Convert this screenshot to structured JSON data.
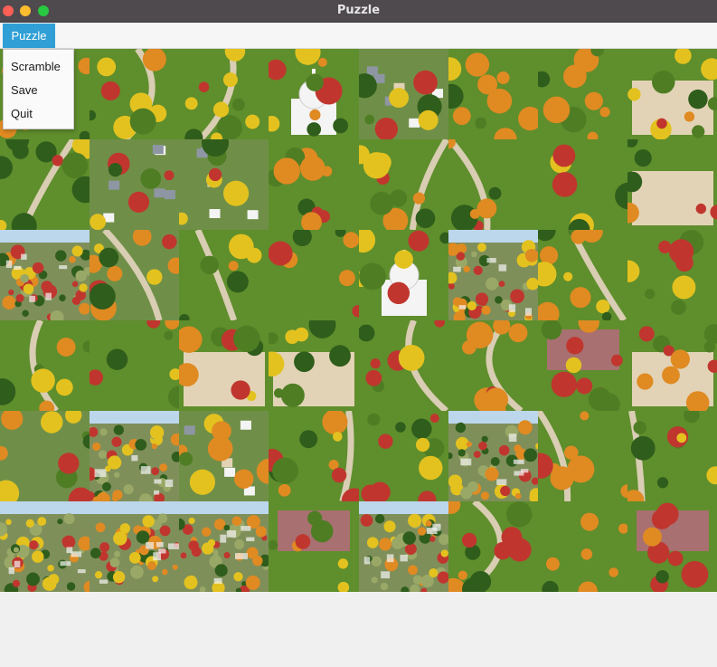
{
  "window": {
    "title": "Puzzle"
  },
  "menubar": {
    "menus": [
      {
        "label": "Puzzle"
      }
    ]
  },
  "dropdown": {
    "items": [
      {
        "label": "Scramble"
      },
      {
        "label": "Save"
      },
      {
        "label": "Quit"
      }
    ]
  },
  "board": {
    "rows": 6,
    "cols": 8,
    "tiles": [
      [
        "trees-grass",
        "trees-path",
        "path-yellow-tree",
        "white-church",
        "campus-houses",
        "orange-trees",
        "orange-tree-grass",
        "building-corner-trees"
      ],
      [
        "trees-path-left",
        "neighborhood-houses",
        "neighborhood-houses",
        "orange-tree-grass",
        "campus-path",
        "trees-path",
        "campus-building",
        "tan-building-facade"
      ],
      [
        "town-skyline",
        "neighborhood-road",
        "yellow-tree-path",
        "green-lawn",
        "white-cupola",
        "town-skyline",
        "orange-trees-road",
        "green-lawn-trees"
      ],
      [
        "trees-path",
        "green-trees",
        "building-tan",
        "building-facade",
        "red-trees-path",
        "orange-tree-path",
        "red-roof-building",
        "building-steps"
      ],
      [
        "street-trees",
        "town-view",
        "houses-orange-trees",
        "campus-road",
        "building-trees",
        "town-view",
        "orange-trees-path",
        "green-lawn-path"
      ],
      [
        "panorama-left",
        "panorama-mid",
        "panorama-right",
        "campus-building-roof",
        "town-view",
        "field-path",
        "orange-trees-grass",
        "red-roof-buildings"
      ]
    ]
  }
}
